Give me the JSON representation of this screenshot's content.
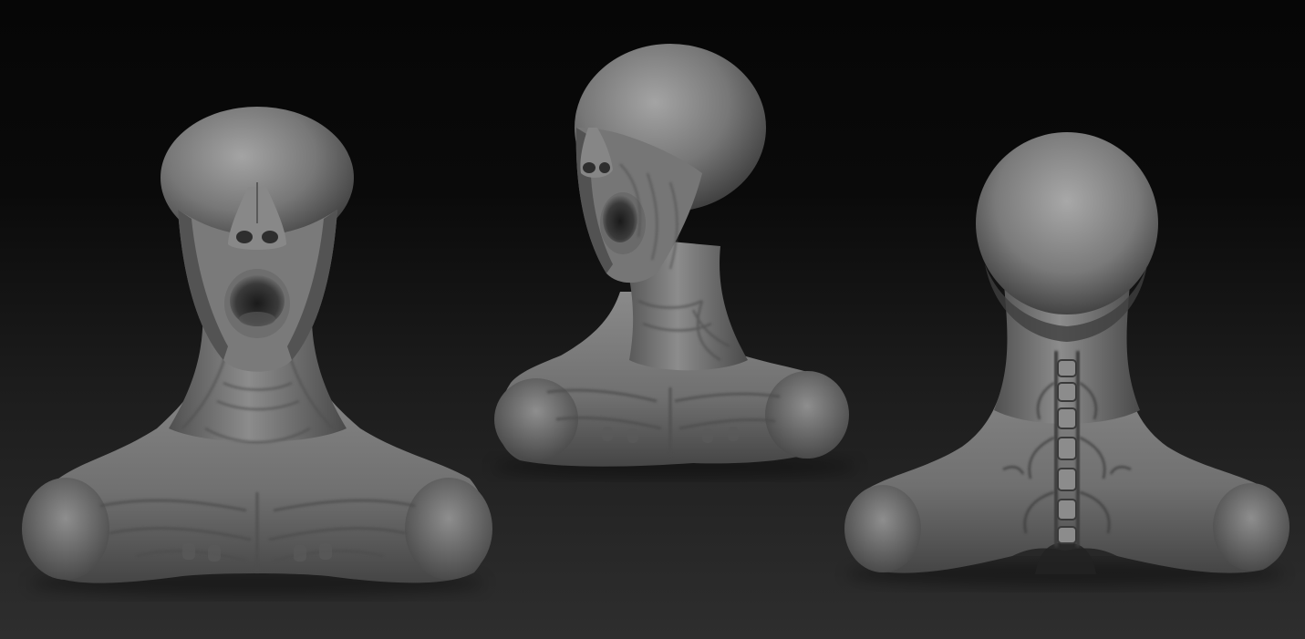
{
  "scene": {
    "views": [
      {
        "view": "front",
        "icon": "bust-front-view"
      },
      {
        "view": "three-quarter",
        "icon": "bust-three-quarter-view"
      },
      {
        "view": "back",
        "icon": "bust-back-view"
      }
    ],
    "colors": {
      "background_top": "#060606",
      "background_bottom": "#2e2e2e",
      "clay_light": "#9a9a9a",
      "clay_mid": "#6e6e6e",
      "clay_dark": "#2f2f2f"
    }
  }
}
